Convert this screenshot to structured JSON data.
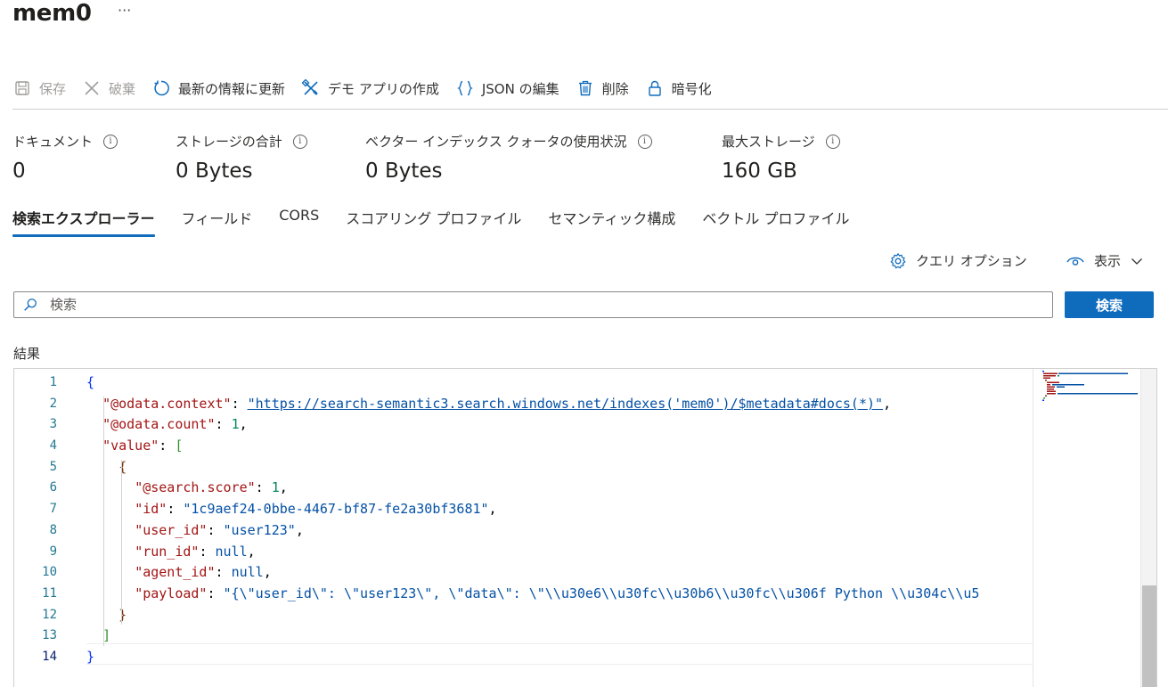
{
  "header": {
    "title": "mem0",
    "more_label": "···"
  },
  "toolbar": {
    "save_label": "保存",
    "discard_label": "破棄",
    "refresh_label": "最新の情報に更新",
    "demo_app_label": "デモ アプリの作成",
    "json_edit_label": "JSON の編集",
    "delete_label": "削除",
    "encrypt_label": "暗号化"
  },
  "stats": [
    {
      "label": "ドキュメント",
      "value": "0"
    },
    {
      "label": "ストレージの合計",
      "value": "0 Bytes"
    },
    {
      "label": "ベクター インデックス クォータの使用状況",
      "value": "0 Bytes"
    },
    {
      "label": "最大ストレージ",
      "value": "160 GB"
    }
  ],
  "tabs": [
    {
      "label": "検索エクスプローラー",
      "active": true
    },
    {
      "label": "フィールド"
    },
    {
      "label": "CORS"
    },
    {
      "label": "スコアリング プロファイル"
    },
    {
      "label": "セマンティック構成"
    },
    {
      "label": "ベクトル プロファイル"
    }
  ],
  "options": {
    "query_options_label": "クエリ オプション",
    "view_label": "表示"
  },
  "search": {
    "placeholder": "検索",
    "value": "",
    "button_label": "検索"
  },
  "results": {
    "label": "結果",
    "active_line": 14,
    "lines": [
      {
        "num": "1",
        "indent": 0,
        "tokens": [
          [
            "b1",
            "{"
          ]
        ]
      },
      {
        "num": "2",
        "indent": 1,
        "tokens": [
          [
            "k",
            "\"@odata.context\""
          ],
          [
            "p",
            ": "
          ],
          [
            "u",
            "\"https://search-semantic3.search.windows.net/indexes('mem0')/$metadata#docs(*)\""
          ],
          [
            "p",
            ","
          ]
        ]
      },
      {
        "num": "3",
        "indent": 1,
        "tokens": [
          [
            "k",
            "\"@odata.count\""
          ],
          [
            "p",
            ": "
          ],
          [
            "n",
            "1"
          ],
          [
            "p",
            ","
          ]
        ]
      },
      {
        "num": "4",
        "indent": 1,
        "tokens": [
          [
            "k",
            "\"value\""
          ],
          [
            "p",
            ": "
          ],
          [
            "b2",
            "["
          ]
        ]
      },
      {
        "num": "5",
        "indent": 2,
        "tokens": [
          [
            "b3",
            "{"
          ]
        ]
      },
      {
        "num": "6",
        "indent": 3,
        "tokens": [
          [
            "k",
            "\"@search.score\""
          ],
          [
            "p",
            ": "
          ],
          [
            "n",
            "1"
          ],
          [
            "p",
            ","
          ]
        ]
      },
      {
        "num": "7",
        "indent": 3,
        "tokens": [
          [
            "k",
            "\"id\""
          ],
          [
            "p",
            ": "
          ],
          [
            "s",
            "\"1c9aef24-0bbe-4467-bf87-fe2a30bf3681\""
          ],
          [
            "p",
            ","
          ]
        ]
      },
      {
        "num": "8",
        "indent": 3,
        "tokens": [
          [
            "k",
            "\"user_id\""
          ],
          [
            "p",
            ": "
          ],
          [
            "s",
            "\"user123\""
          ],
          [
            "p",
            ","
          ]
        ]
      },
      {
        "num": "9",
        "indent": 3,
        "tokens": [
          [
            "k",
            "\"run_id\""
          ],
          [
            "p",
            ": "
          ],
          [
            "nl",
            "null"
          ],
          [
            "p",
            ","
          ]
        ]
      },
      {
        "num": "10",
        "indent": 3,
        "tokens": [
          [
            "k",
            "\"agent_id\""
          ],
          [
            "p",
            ": "
          ],
          [
            "nl",
            "null"
          ],
          [
            "p",
            ","
          ]
        ]
      },
      {
        "num": "11",
        "indent": 3,
        "tokens": [
          [
            "k",
            "\"payload\""
          ],
          [
            "p",
            ": "
          ],
          [
            "s",
            "\"{\\\"user_id\\\": \\\"user123\\\", \\\"data\\\": \\\"\\\\u30e6\\\\u30fc\\\\u30b6\\\\u30fc\\\\u306f Python \\\\u304c\\\\u5"
          ]
        ]
      },
      {
        "num": "12",
        "indent": 2,
        "tokens": [
          [
            "b3",
            "}"
          ]
        ]
      },
      {
        "num": "13",
        "indent": 1,
        "tokens": [
          [
            "b2",
            "]"
          ]
        ]
      },
      {
        "num": "14",
        "indent": 0,
        "tokens": [
          [
            "b1",
            "}"
          ]
        ]
      }
    ]
  },
  "colors": {
    "accent": "#0f6cbd",
    "json_key": "#a31515",
    "json_string": "#0451a5",
    "json_number": "#098658",
    "line_number": "#237893"
  }
}
